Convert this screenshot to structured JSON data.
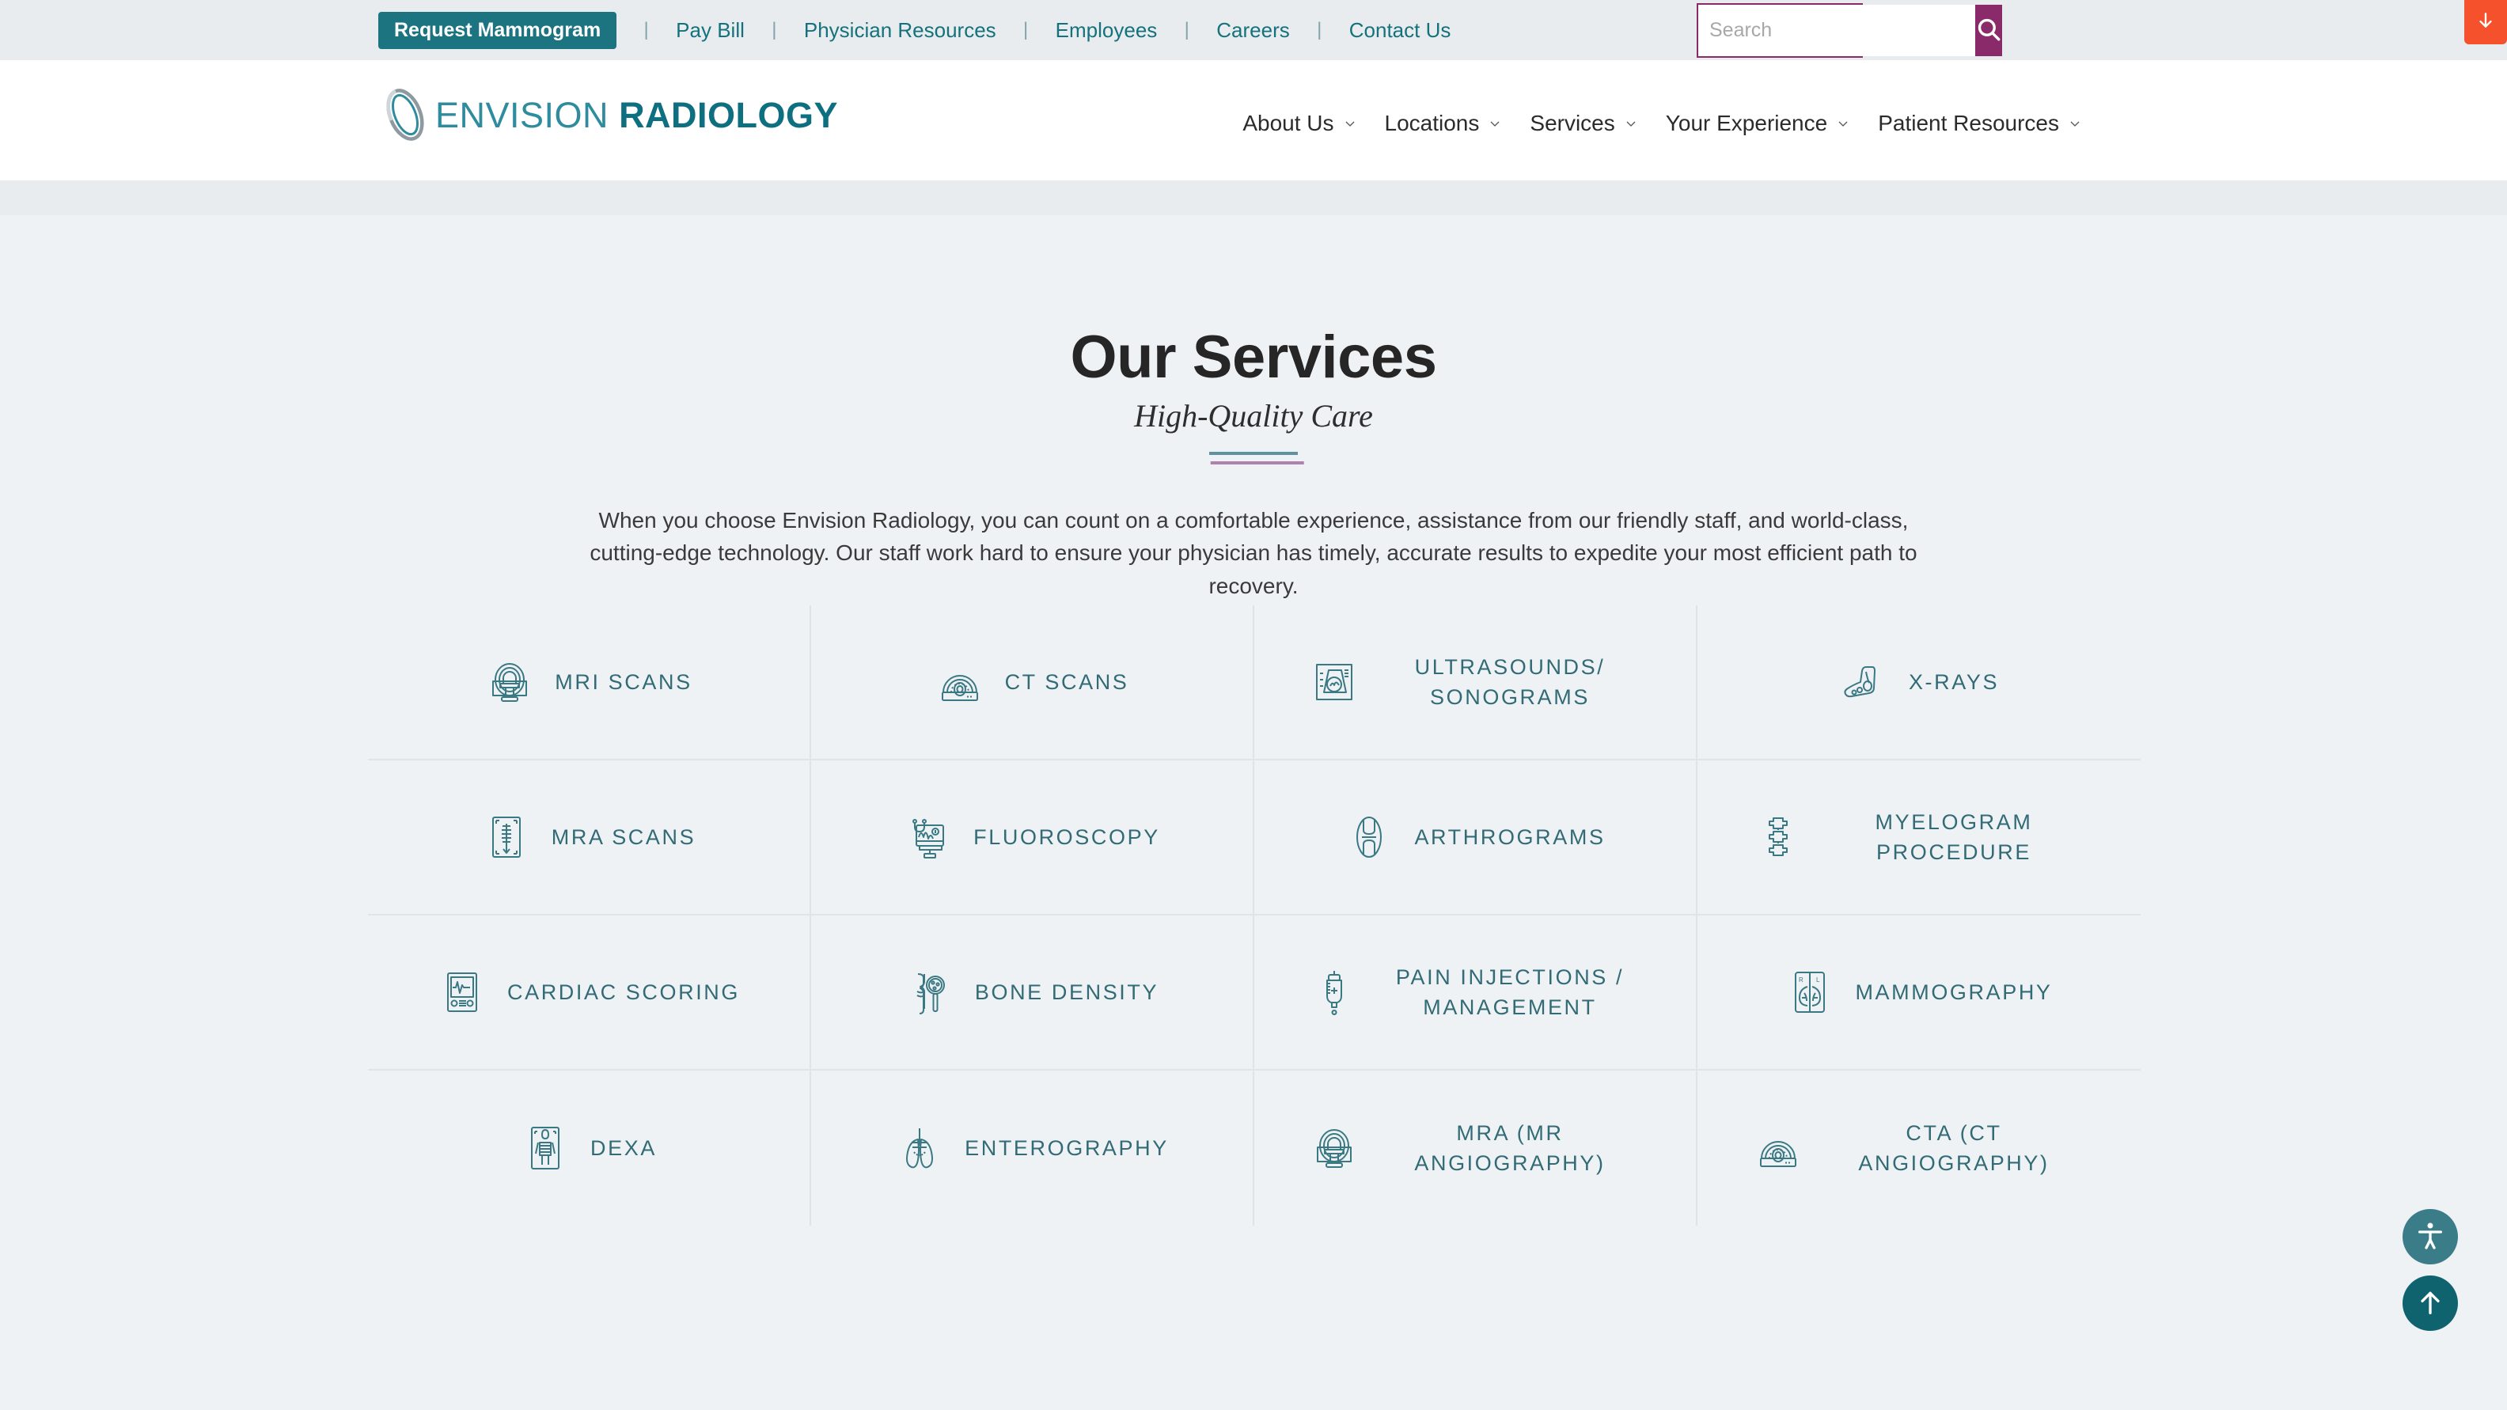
{
  "utility_bar": {
    "cta_label": "Request Mammogram",
    "separator": "|",
    "links": [
      "Pay Bill",
      "Physician Resources",
      "Employees",
      "Careers",
      "Contact Us"
    ],
    "search": {
      "placeholder": "Search",
      "value": "",
      "icon": "search-icon"
    },
    "download_tab": {
      "icon": "arrow-down-icon"
    }
  },
  "header": {
    "logo": {
      "mark": "envision-oval-mark",
      "word1": "ENVISION",
      "word2": "RADIOLOGY"
    },
    "nav": [
      {
        "label": "About Us",
        "has_dropdown": true
      },
      {
        "label": "Locations",
        "has_dropdown": true
      },
      {
        "label": "Services",
        "has_dropdown": true
      },
      {
        "label": "Your Experience",
        "has_dropdown": true
      },
      {
        "label": "Patient Resources",
        "has_dropdown": true
      }
    ]
  },
  "hero": {
    "title": "Our Services",
    "subtitle": "High-Quality Care",
    "intro": "When you choose Envision Radiology, you can count on a comfortable experience, assistance from our friendly staff, and world-class, cutting-edge technology. Our staff work hard to ensure your physician has timely, accurate results to expedite your most efficient path to recovery."
  },
  "services": [
    {
      "label": "MRI SCANS",
      "icon": "mri-machine-icon"
    },
    {
      "label": "CT SCANS",
      "icon": "ct-scanner-icon"
    },
    {
      "label": "ULTRASOUNDS/ SONOGRAMS",
      "icon": "ultrasound-image-icon"
    },
    {
      "label": "X-RAYS",
      "icon": "foot-bones-icon"
    },
    {
      "label": "MRA SCANS",
      "icon": "spine-film-icon"
    },
    {
      "label": "FLUOROSCOPY",
      "icon": "monitor-waveform-icon"
    },
    {
      "label": "ARTHROGRAMS",
      "icon": "knee-joint-icon"
    },
    {
      "label": "MYELOGRAM PROCEDURE",
      "icon": "vertebrae-icon"
    },
    {
      "label": "CARDIAC SCORING",
      "icon": "ecg-monitor-icon"
    },
    {
      "label": "BONE DENSITY",
      "icon": "bone-magnifier-icon"
    },
    {
      "label": "PAIN INJECTIONS / MANAGEMENT",
      "icon": "syringe-drip-icon"
    },
    {
      "label": "MAMMOGRAPHY",
      "icon": "breast-film-icon"
    },
    {
      "label": "DEXA",
      "icon": "skeleton-film-icon"
    },
    {
      "label": "ENTEROGRAPHY",
      "icon": "lungs-icon"
    },
    {
      "label": "MRA (MR ANGIOGRAPHY)",
      "icon": "mri-machine-icon"
    },
    {
      "label": "CTA (CT ANGIOGRAPHY)",
      "icon": "ct-scanner-icon"
    }
  ],
  "floating": {
    "accessibility": {
      "icon": "accessibility-person-icon"
    },
    "scroll_top": {
      "icon": "arrow-up-icon"
    }
  },
  "colors": {
    "teal_cta": "#1b7480",
    "teal_link": "#14727c",
    "teal_label": "#326b75",
    "purple_search": "#8b2a6b",
    "orange_tab": "#f4512c",
    "page_bg": "#eff2f5",
    "band_bg": "#e9ecef",
    "rule_teal": "#5f929c",
    "rule_purple": "#ad82ad"
  }
}
